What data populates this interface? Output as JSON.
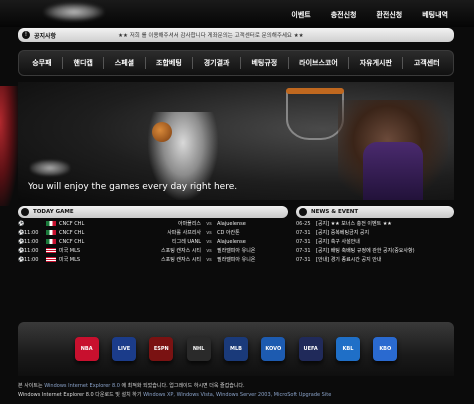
{
  "top_nav": [
    "이벤트",
    "충전신청",
    "환전신청",
    "베팅내역"
  ],
  "notice": {
    "label": "공지사항",
    "text": "★★ 저희                 를 이용해주셔서 감사합니다 게좌문의는 고객센터로 문의해주세요 ★★"
  },
  "menu": [
    "승무패",
    "핸디캡",
    "스페셜",
    "조합베팅",
    "경기결과",
    "베팅규정",
    "라이브스코어",
    "자유게시판",
    "고객센터"
  ],
  "hero": {
    "tagline": "You will enjoy the games every day right here."
  },
  "today_game": {
    "title": "TODAY GAME",
    "rows": [
      {
        "time": "",
        "league": "CNCF CHL",
        "match": "아마폴리스",
        "vs": "vs",
        "team": "Alajuelense",
        "flag": "mx"
      },
      {
        "time": "11:00",
        "league": "CNCF CHL",
        "match": "사파롤 사프리사",
        "vs": "vs",
        "team": "CD 아칸톤",
        "flag": "mx"
      },
      {
        "time": "11:00",
        "league": "CNCF CHL",
        "match": "티그레 UANL",
        "vs": "vs",
        "team": "Alajuelense",
        "flag": "mx"
      },
      {
        "time": "11:00",
        "league": "미국 MLS",
        "match": "스포팅 캔자스 시티",
        "vs": "vs",
        "team": "필라델피아 유니온",
        "flag": "us"
      },
      {
        "time": "11:00",
        "league": "미국 MLS",
        "match": "스포팅 캔자스 시티",
        "vs": "vs",
        "team": "필라델피아 유니온",
        "flag": "us"
      }
    ]
  },
  "news": {
    "title": "NEWS & EVENT",
    "rows": [
      {
        "date": "06-25",
        "title": "[공지] ★★ 보너스 충전 이벤트 ★★"
      },
      {
        "date": "07-31",
        "title": "[공지] 중복베팅금지 공지"
      },
      {
        "date": "07-31",
        "title": "[공지] 축구 사설안내"
      },
      {
        "date": "07-31",
        "title": "[공지] 배팅 축배팅 규정에 관한 공지(중요사항)"
      },
      {
        "date": "07-31",
        "title": "[안내] 경기 종료시간 공지 안내"
      }
    ]
  },
  "logos": [
    {
      "label": "NBA",
      "color": "#c8102e"
    },
    {
      "label": "LIVE",
      "color": "#1b3c8a"
    },
    {
      "label": "ESPN",
      "color": "#7a1212"
    },
    {
      "label": "NHL",
      "color": "#2a2a2a"
    },
    {
      "label": "MLB",
      "color": "#1a3a7a"
    },
    {
      "label": "KOVO",
      "color": "#1d5bb0"
    },
    {
      "label": "UEFA",
      "color": "#202a5a"
    },
    {
      "label": "KBL",
      "color": "#1f6fc7"
    },
    {
      "label": "KBO",
      "color": "#2a6ad0"
    }
  ],
  "footer": {
    "line1_a": "본 사이트는 ",
    "line1_b": "Windows Internet Explorer 8.0",
    "line1_c": " 에 최적화 되었습니다. 업그레이드 하시면 더욱 즐겁습니다.",
    "line2_a": "Windows Internet Explorer 8.0 다운로드 및 설치 하기 ",
    "line2_b": "Windows XP, Windows Vista, Windows Server 2003, MicroSoft Upgrade Site"
  }
}
